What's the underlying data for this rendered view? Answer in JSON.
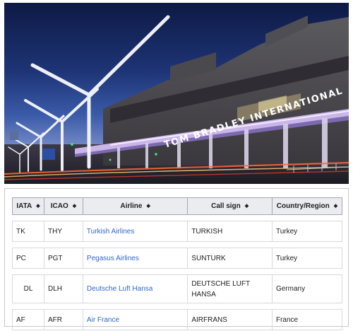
{
  "photo": {
    "sign_text": "TOM BRADLEY INTERNATIONAL"
  },
  "table": {
    "headers": [
      "IATA",
      "ICAO",
      "Airline",
      "Call sign",
      "Country/Region"
    ],
    "sort_icon": "sort-arrows-icon",
    "link_color": "#3366cc",
    "rows": [
      {
        "iata": "TK",
        "icao": "THY",
        "airline": "Turkish Airlines",
        "callsign": "TURKISH",
        "country": "Turkey"
      },
      {
        "iata": "PC",
        "icao": "PGT",
        "airline": "Pegasus Airlines",
        "callsign": "SUNTURK",
        "country": "Turkey"
      },
      {
        "iata": "DL",
        "icao": "DLH",
        "airline": "Deutsche Luft Hansa",
        "callsign": "DEUTSCHE LUFT HANSA",
        "country": "Germany"
      },
      {
        "iata": "AF",
        "icao": "AFR",
        "airline": "Air France",
        "callsign": "AIRFRANS",
        "country": "France"
      }
    ]
  }
}
